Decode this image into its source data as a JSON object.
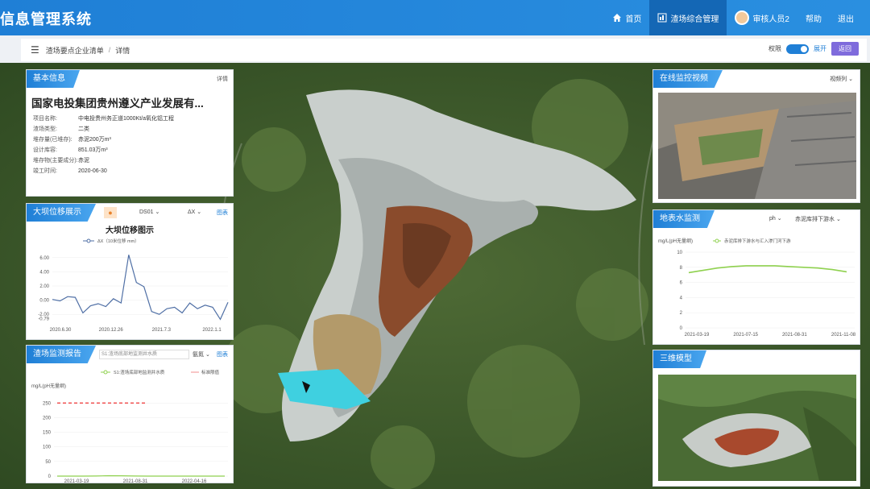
{
  "app": {
    "title": "信息管理系统"
  },
  "nav": [
    {
      "label": "首页",
      "icon": "home-icon"
    },
    {
      "label": "渣场综合管理",
      "icon": "dashboard-icon"
    },
    {
      "label": "审核人员2",
      "icon": "avatar"
    },
    {
      "label": "帮助",
      "icon": ""
    },
    {
      "label": "退出",
      "icon": ""
    }
  ],
  "breadcrumb": {
    "items": [
      "渣场要点企业清单",
      "详情"
    ],
    "label_b": "权限",
    "label_e": "展开",
    "back": "返回"
  },
  "basic_info": {
    "title": "基本信息",
    "more": "详情",
    "company": "国家电投集团贵州遵义产业发展有...",
    "rows": [
      {
        "k": "项目名称:",
        "v": "中电投贵州务正道1000Kt/a氧化铝工程"
      },
      {
        "k": "渣场类型:",
        "v": "二类"
      },
      {
        "k": "堆存量(已堆存):",
        "v": "赤泥200万m³"
      },
      {
        "k": "设计库容:",
        "v": "851.03万m³"
      },
      {
        "k": "堆存物(主要成分):",
        "v": "赤泥"
      },
      {
        "k": "竣工时间:",
        "v": "2020-06-30"
      }
    ]
  },
  "displacement": {
    "title": "大坝位移展示",
    "sel1": "DS01",
    "sel2": "ΔX",
    "link": "图表",
    "chart_title": "大坝位移图示",
    "legend": "ΔX（10米位移 mm）"
  },
  "waste_monitor": {
    "title": "渣场监测报告",
    "sel1": "S1:渣场底部地监测井水质",
    "sel2": "氨氮",
    "link": "图表",
    "legend1": "S1:渣场底部地监测井水质",
    "legend2": "标准限值",
    "ylabel": "mg/L(pH无量纲)"
  },
  "video": {
    "title": "在线监控视频",
    "sel": "视频列"
  },
  "surface_water": {
    "title": "地表水监测",
    "sel1": "ph",
    "sel2": "赤泥库排下游水",
    "ylabel": "mg/L(pH无量纲)",
    "legend": "赤泥库排下游水与汇入渗门河下游"
  },
  "model3d": {
    "title": "三维模型"
  },
  "chart_data": [
    {
      "type": "line",
      "title": "大坝位移图示",
      "x": [
        "2020.6.30",
        "2020.12.26",
        "2021.7.3",
        "2022.1.1"
      ],
      "series": [
        {
          "name": "ΔX（10米位移 mm）",
          "values": [
            0.1,
            -0.1,
            0.5,
            0.4,
            -1.8,
            -0.8,
            -0.5,
            -0.9,
            0.2,
            -0.4,
            6.4,
            2.5,
            1.9,
            -1.6,
            -2.0,
            -1.2,
            -1.0,
            -1.8,
            -0.4,
            -1.2,
            -0.7,
            -1.0,
            -2.7,
            -0.3
          ]
        }
      ],
      "yticks": [
        "6.00",
        "4.00",
        "2.00",
        "0.00",
        "-2.00",
        "-0.79"
      ],
      "ylim": [
        -3,
        7
      ]
    },
    {
      "type": "line",
      "x": [
        "2021-03-19",
        "2021-08-31",
        "2022-04-16"
      ],
      "series": [
        {
          "name": "S1:渣场底部地监测井水质",
          "values": [
            0,
            0,
            0,
            0.3,
            1.5,
            1.0,
            0.2,
            0.1,
            0,
            0,
            0,
            0,
            0,
            0
          ]
        },
        {
          "name": "标准限值",
          "values": [
            250,
            250,
            250,
            250,
            250,
            250,
            250,
            250,
            250,
            250,
            250,
            250,
            250,
            250
          ]
        }
      ],
      "yticks": [
        250,
        200,
        150,
        100,
        50,
        0
      ],
      "ylim": [
        0,
        270
      ]
    },
    {
      "type": "line",
      "x": [
        "2021-03-19",
        "2021-07-15",
        "2021-08-31",
        "2021-11-08"
      ],
      "series": [
        {
          "name": "赤泥库排下游水与汇入渗门河下游",
          "values": [
            7.3,
            7.6,
            7.9,
            8.1,
            8.2,
            8.2,
            8.2,
            8.1,
            8.0,
            7.9,
            7.7,
            7.4
          ]
        }
      ],
      "yticks": [
        10,
        8,
        6,
        4,
        2,
        0
      ],
      "ylim": [
        0,
        10
      ]
    }
  ]
}
